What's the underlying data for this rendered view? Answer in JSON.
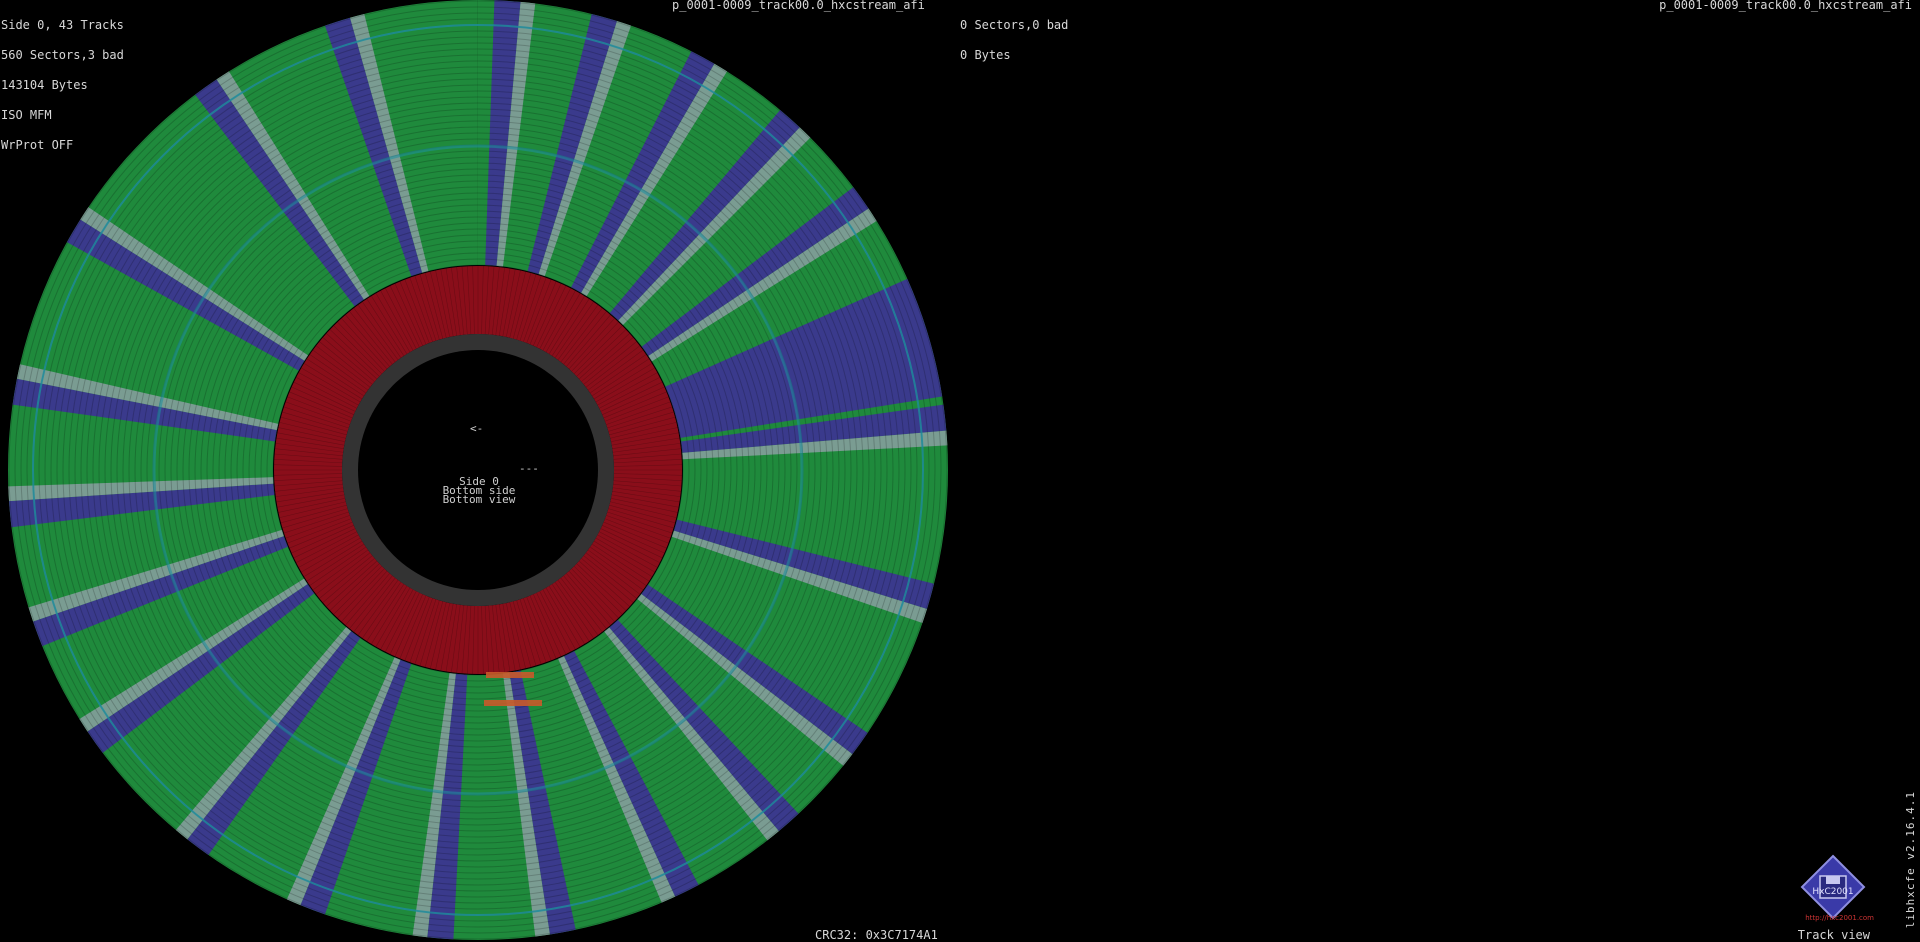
{
  "left_side": {
    "info_lines": [
      "Side 0, 43 Tracks",
      "560 Sectors,3 bad",
      "143104 Bytes",
      "ISO MFM",
      "WrProt OFF"
    ],
    "filename": "p_0001-0009_track00.0_hxcstream_afi"
  },
  "right_side": {
    "info_lines": [
      "0 Sectors,0 bad",
      "0 Bytes"
    ],
    "filename": "p_0001-0009_track00.0_hxcstream_afi"
  },
  "disk_center": {
    "arrow": "<-",
    "dash": "---",
    "side": "Side 0",
    "side_desc": "Bottom side",
    "view_desc": "Bottom view"
  },
  "footer": {
    "crc": "CRC32: 0x3C7174A1",
    "view_mode": "Track view",
    "version": "libhxcfe v2.16.4.1",
    "logo_text": "HxC2001",
    "logo_url": "http://hxc2001.com"
  },
  "colors": {
    "good_sector": "#1f8a3c",
    "sector_gap": "#3a3a8c",
    "sync_mark": "#7a9c92",
    "bad_sector": "#8a0e1a",
    "hub": "#333333",
    "background": "#000000"
  }
}
